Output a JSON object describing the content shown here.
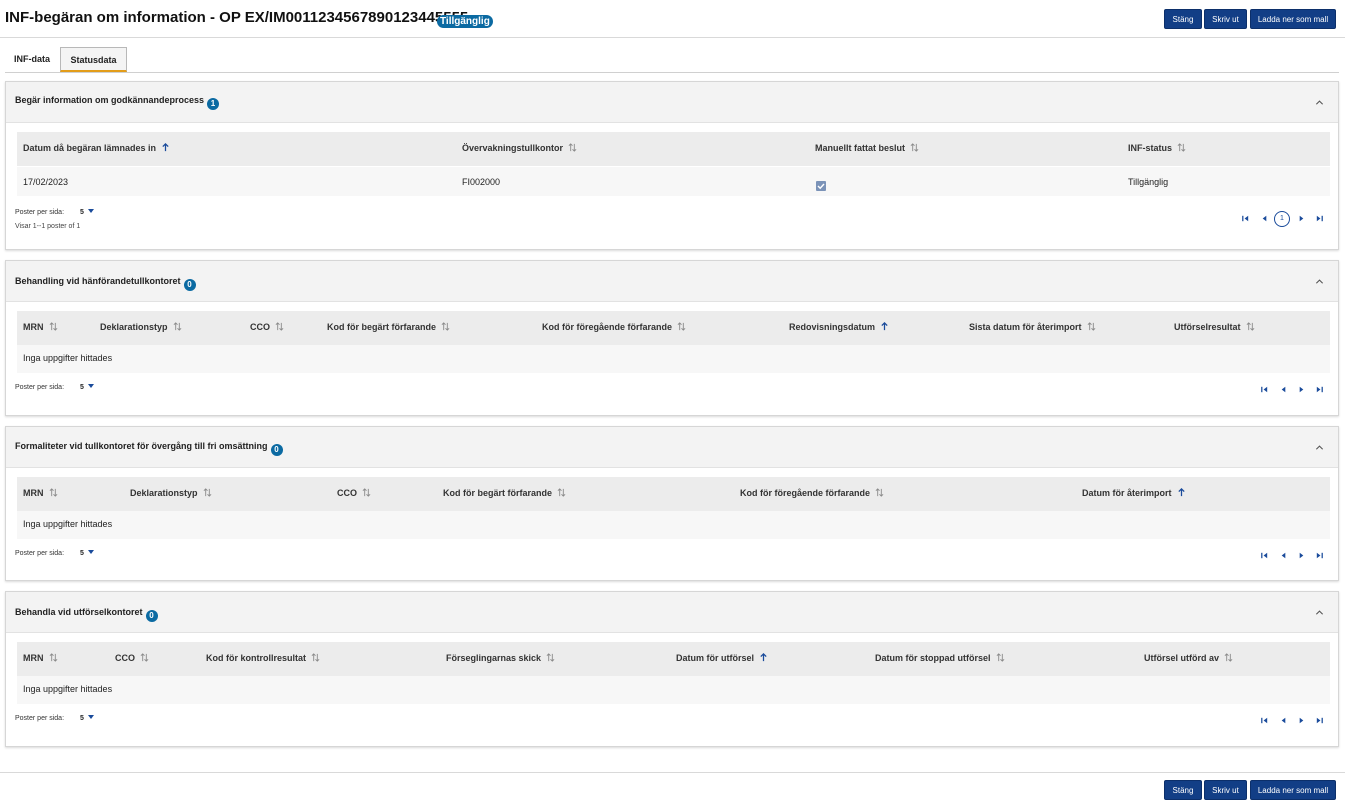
{
  "header": {
    "title": "INF-begäran om information - OP EX/IM0011234567890123445555",
    "status_badge": "Tillgänglig",
    "buttons": {
      "close": "Stäng",
      "print": "Skriv ut",
      "download": "Ladda ner som mall"
    }
  },
  "tabs": [
    {
      "label": "INF-data",
      "active": false
    },
    {
      "label": "Statusdata",
      "active": true
    }
  ],
  "icons": {
    "sort_default": "sort-updown-icon",
    "sort_asc": "sort-asc-arrow-icon",
    "collapse": "chevron-up-icon",
    "pager": [
      "first-page-icon",
      "prev-page-icon",
      "next-page-icon",
      "last-page-icon"
    ]
  },
  "colors": {
    "primary_button": "#123e86",
    "badge": "#0b6aa2",
    "active_tab_accent": "#e39d1a",
    "sort_asc": "#1a4b9b"
  },
  "sections": [
    {
      "title": "Begär information om godkännandeprocess",
      "count": "1",
      "columns": [
        "Datum då begäran lämnades in",
        "Övervakningstullkontor",
        "Manuellt fattat beslut",
        "INF-status"
      ],
      "rows": [
        {
          "date": "17/02/2023",
          "office": "FI002000",
          "manual_decision": true,
          "status": "Tillgänglig"
        }
      ],
      "per_page_label": "Poster per sida:",
      "per_page_value": "5",
      "showing": "Visar 1--1 poster of 1",
      "current_page": "1"
    },
    {
      "title": "Behandling vid hänförandetullkontoret",
      "count": "0",
      "columns": [
        "MRN",
        "Deklarationstyp",
        "CCO",
        "Kod för begärt förfarande",
        "Kod för föregående förfarande",
        "Redovisningsdatum",
        "Sista datum för återimport",
        "Utförselresultat"
      ],
      "empty": "Inga uppgifter hittades",
      "per_page_label": "Poster per sida:",
      "per_page_value": "5"
    },
    {
      "title": "Formaliteter vid tullkontoret för övergång till fri omsättning",
      "count": "0",
      "columns": [
        "MRN",
        "Deklarationstyp",
        "CCO",
        "Kod för begärt förfarande",
        "Kod för föregående förfarande",
        "Datum för återimport"
      ],
      "empty": "Inga uppgifter hittades",
      "per_page_label": "Poster per sida:",
      "per_page_value": "5"
    },
    {
      "title": "Behandla vid utförselkontoret",
      "count": "0",
      "columns": [
        "MRN",
        "CCO",
        "Kod för kontrollresultat",
        "Förseglingarnas skick",
        "Datum för utförsel",
        "Datum för stoppad utförsel",
        "Utförsel utförd av"
      ],
      "empty": "Inga uppgifter hittades",
      "per_page_label": "Poster per sida:",
      "per_page_value": "5"
    }
  ],
  "footer": {
    "buttons": {
      "close": "Stäng",
      "print": "Skriv ut",
      "download": "Ladda ner som mall"
    }
  }
}
